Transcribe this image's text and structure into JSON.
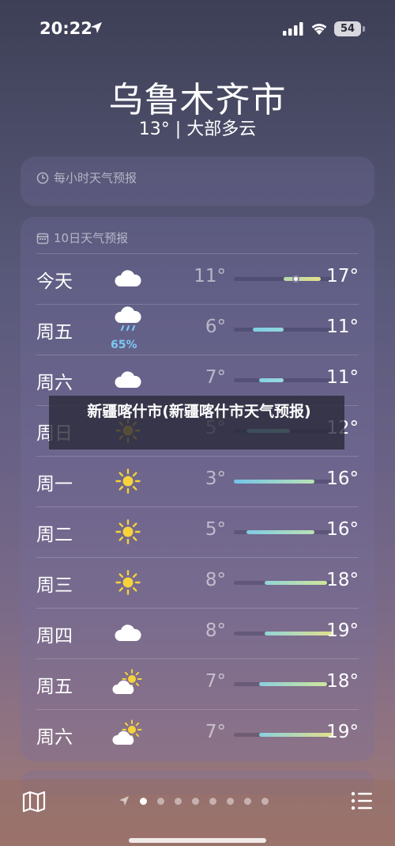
{
  "status_bar": {
    "time": "20:22",
    "battery": "54"
  },
  "location": {
    "city": "乌鲁木齐市",
    "conditions": "13° | 大部多云"
  },
  "hourly_card": {
    "title": "每小时天气预报"
  },
  "forecast_card": {
    "title": "10日天气预报",
    "scale": {
      "min": 3,
      "max": 19
    },
    "days": [
      {
        "day": "今天",
        "icon": "cloud-icon",
        "low": "11°",
        "high": "17°",
        "low_value": 11,
        "high_value": 17,
        "current_value": 13,
        "precip": "",
        "bar_colors": [
          "#b7d8b0",
          "#e3e08a"
        ]
      },
      {
        "day": "周五",
        "icon": "rain-cloud-icon",
        "low": "6°",
        "high": "11°",
        "low_value": 6,
        "high_value": 11,
        "precip": "65%",
        "bar_colors": [
          "#7fcfe4",
          "#93d6e0"
        ]
      },
      {
        "day": "周六",
        "icon": "cloud-icon",
        "low": "7°",
        "high": "11°",
        "low_value": 7,
        "high_value": 11,
        "precip": "",
        "bar_colors": [
          "#86d2e6",
          "#9bd8e0"
        ]
      },
      {
        "day": "周日",
        "icon": "sun-icon",
        "low": "5°",
        "high": "12°",
        "low_value": 5,
        "high_value": 12,
        "precip": "",
        "bar_colors": [
          "#7ecbe0",
          "#a2dccb"
        ]
      },
      {
        "day": "周一",
        "icon": "sun-icon",
        "low": "3°",
        "high": "16°",
        "low_value": 3,
        "high_value": 16,
        "precip": "",
        "bar_colors": [
          "#73c5ea",
          "#b9e2b4"
        ]
      },
      {
        "day": "周二",
        "icon": "sun-icon",
        "low": "5°",
        "high": "16°",
        "low_value": 5,
        "high_value": 16,
        "precip": "",
        "bar_colors": [
          "#80cbe3",
          "#b9e2b4"
        ]
      },
      {
        "day": "周三",
        "icon": "sun-icon",
        "low": "8°",
        "high": "18°",
        "low_value": 8,
        "high_value": 18,
        "precip": "",
        "bar_colors": [
          "#92d4d8",
          "#cfe69a"
        ]
      },
      {
        "day": "周四",
        "icon": "cloud-icon",
        "low": "8°",
        "high": "19°",
        "low_value": 8,
        "high_value": 19,
        "precip": "",
        "bar_colors": [
          "#92d4d8",
          "#e3e08a"
        ]
      },
      {
        "day": "周五",
        "icon": "partly-sunny-icon",
        "low": "7°",
        "high": "18°",
        "low_value": 7,
        "high_value": 18,
        "precip": "",
        "bar_colors": [
          "#8ad0dd",
          "#cfe69a"
        ]
      },
      {
        "day": "周六",
        "icon": "partly-sunny-icon",
        "low": "7°",
        "high": "19°",
        "low_value": 7,
        "high_value": 19,
        "precip": "",
        "bar_colors": [
          "#8ad0dd",
          "#e3e08a"
        ]
      }
    ]
  },
  "overlay": {
    "text": "新疆喀什市(新疆喀什市天气预报)"
  },
  "bottom_bar": {
    "page_count": 8,
    "active_page": 1
  }
}
